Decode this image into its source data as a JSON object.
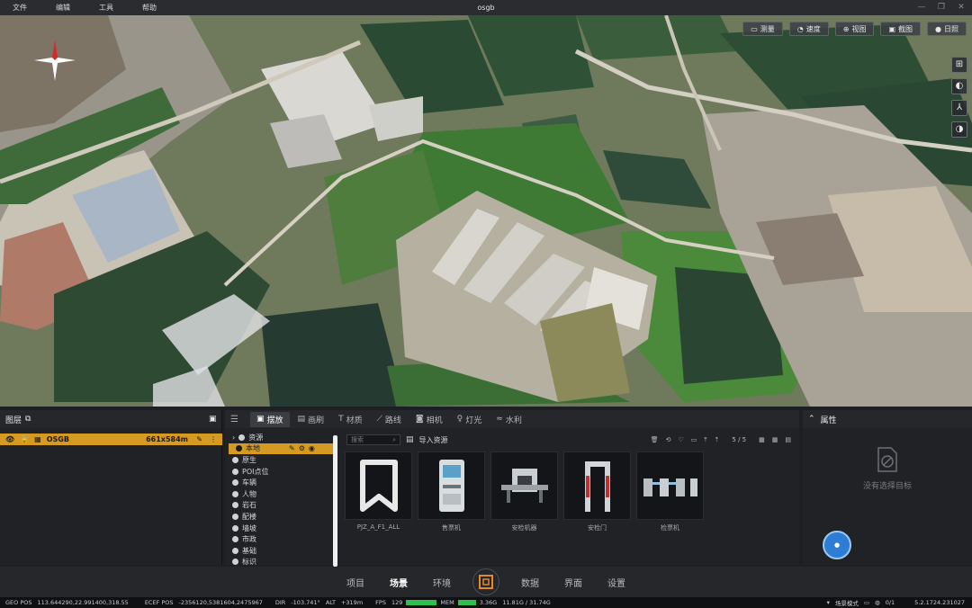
{
  "menu": [
    "文件",
    "编辑",
    "工具",
    "帮助"
  ],
  "app_title": "osgb",
  "viewport_toolbar": [
    {
      "label": "测量",
      "icon": "ruler-icon"
    },
    {
      "label": "速度",
      "icon": "speed-icon"
    },
    {
      "label": "视图",
      "icon": "view-icon"
    },
    {
      "label": "截图",
      "icon": "screenshot-icon"
    },
    {
      "label": "日照",
      "icon": "sun-icon"
    }
  ],
  "viewport_side": [
    "globe-icon",
    "earth-icon",
    "axes-icon",
    "layers-globe-icon"
  ],
  "layers": {
    "title": "图层",
    "row": {
      "name": "OSGB",
      "size": "661x584m"
    }
  },
  "tabs": [
    {
      "label": "摆放",
      "active": true
    },
    {
      "label": "画刷",
      "active": false
    },
    {
      "label": "材质",
      "active": false
    },
    {
      "label": "路线",
      "active": false
    },
    {
      "label": "相机",
      "active": false
    },
    {
      "label": "灯光",
      "active": false
    },
    {
      "label": "水利",
      "active": false
    }
  ],
  "tree": [
    {
      "label": "资源",
      "selected": false
    },
    {
      "label": "本地",
      "selected": true
    },
    {
      "label": "原生",
      "selected": false
    },
    {
      "label": "POI点位",
      "selected": false
    },
    {
      "label": "车辆",
      "selected": false
    },
    {
      "label": "人物",
      "selected": false
    },
    {
      "label": "岩石",
      "selected": false
    },
    {
      "label": "配楼",
      "selected": false
    },
    {
      "label": "墙坡",
      "selected": false
    },
    {
      "label": "市政",
      "selected": false
    },
    {
      "label": "基础",
      "selected": false
    },
    {
      "label": "标识",
      "selected": false
    }
  ],
  "asset_toolbar": {
    "search_placeholder": "搜索",
    "import_label": "导入资源",
    "page": "5 / 5"
  },
  "assets": [
    {
      "label": "PJZ_A_F1_ALL",
      "icon": "bookmark-icon"
    },
    {
      "label": "售票机",
      "icon": "ticket-machine-icon"
    },
    {
      "label": "安检机器",
      "icon": "xray-machine-icon"
    },
    {
      "label": "安检门",
      "icon": "security-gate-icon"
    },
    {
      "label": "检票机",
      "icon": "turnstile-icon"
    }
  ],
  "properties": {
    "title": "属性",
    "empty_text": "没有选择目标"
  },
  "bottom_nav": [
    {
      "label": "项目",
      "active": false
    },
    {
      "label": "场景",
      "active": true
    },
    {
      "label": "环境",
      "active": false
    },
    {
      "label": "数据",
      "active": false
    },
    {
      "label": "界面",
      "active": false
    },
    {
      "label": "设置",
      "active": false
    }
  ],
  "status": {
    "geo_label": "GEO POS",
    "geo_value": "113.644290,22.991400,318.55",
    "ecef_label": "ECEF POS",
    "ecef_value": "-2356120,5381604,2475967",
    "dir_label": "DIR",
    "dir_value": "-103.741°",
    "alt_label": "ALT",
    "alt_value": "+319m",
    "fps_label": "FPS",
    "fps_value": "129",
    "mem_label": "MEM",
    "mem_value": "3.36G",
    "mem_detail": "11.81G / 31.74G",
    "mode_label": "场景模式",
    "count": "0/1",
    "version": "5.2.1724.231027"
  }
}
